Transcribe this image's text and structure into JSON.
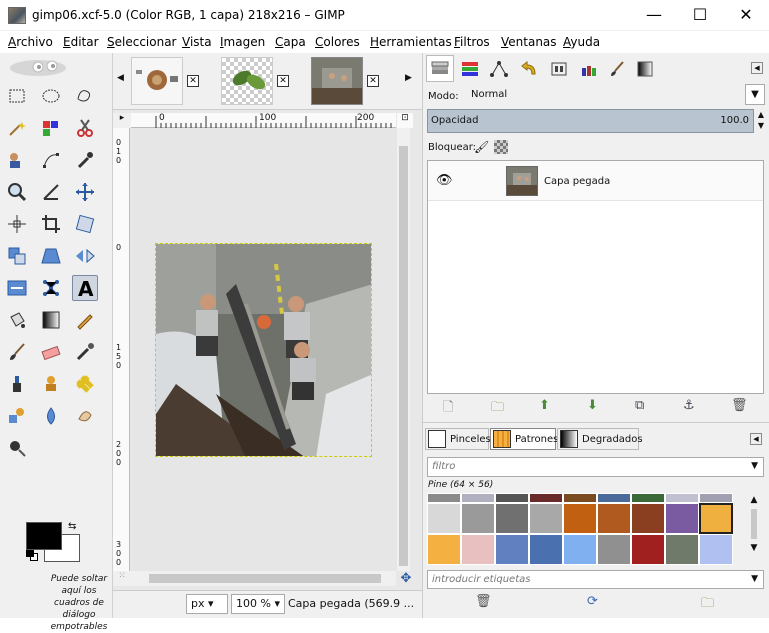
{
  "window": {
    "title": "gimp06.xcf-5.0 (Color RGB, 1 capa) 218x216 – GIMP",
    "minimize": "—",
    "maximize": "☐",
    "close": "✕"
  },
  "menu": [
    {
      "u": "A",
      "rest": "rchivo"
    },
    {
      "u": "E",
      "rest": "ditar"
    },
    {
      "u": "S",
      "rest": "eleccionar"
    },
    {
      "u": "V",
      "rest": "ista"
    },
    {
      "u": "I",
      "rest": "magen"
    },
    {
      "u": "C",
      "rest": "apa"
    },
    {
      "u": "C",
      "rest": "olores"
    },
    {
      "u": "H",
      "rest": "erramientas"
    },
    {
      "u": "F",
      "rest": "iltros"
    },
    {
      "u": "V",
      "rest": "entanas"
    },
    {
      "u": "A",
      "rest": "yuda"
    }
  ],
  "toolbox": {
    "tools": [
      "rect-select",
      "ellipse-select",
      "free-select",
      "fuzzy-select",
      "by-color-select",
      "scissors-select",
      "foreground-select",
      "paths",
      "color-picker",
      "zoom",
      "measure",
      "move",
      "align",
      "crop",
      "unified-transform",
      "rotate",
      "perspective",
      "text-flip",
      "cage-transform",
      "warp-transform",
      "text",
      "bucket-fill",
      "gradient",
      "pencil",
      "paintbrush",
      "eraser",
      "airbrush",
      "ink",
      "clone",
      "heal",
      "perspective-clone",
      "blur",
      "smudge",
      "dodge-burn"
    ],
    "active_tool": "text",
    "hint": "Puede soltar aquí los cuadros de diálogo empotrables",
    "fg_color": "#000000",
    "bg_color": "#ffffff"
  },
  "image_tabs": {
    "nav_left": "◀",
    "nav_right": "▶",
    "close": "✕"
  },
  "rulers": {
    "h_ticks": [
      "0",
      "100",
      "200"
    ],
    "v_ticks": [
      "0",
      "1",
      "0",
      "0",
      "1",
      "5",
      "0",
      "2",
      "0",
      "0",
      "3",
      "0",
      "0"
    ]
  },
  "statusbar": {
    "unit": "px",
    "zoom": "100 %",
    "message": "Capa pegada (569.9 ..."
  },
  "dock_top": {
    "mode_label": "Modo:",
    "mode_value": "Normal",
    "opacity_label": "Opacidad",
    "opacity_value": "100.0",
    "lock_label": "Bloquear:",
    "layers": [
      {
        "name": "Capa pegada",
        "visible": true
      }
    ]
  },
  "dock_bottom": {
    "tabs": [
      "Pinceles",
      "Patrones",
      "Degradados"
    ],
    "active_tab": "Patrones",
    "filter_placeholder": "filtro",
    "pattern_name": "Pine (64 × 56)",
    "tags_placeholder": "introducir etiquetas"
  }
}
